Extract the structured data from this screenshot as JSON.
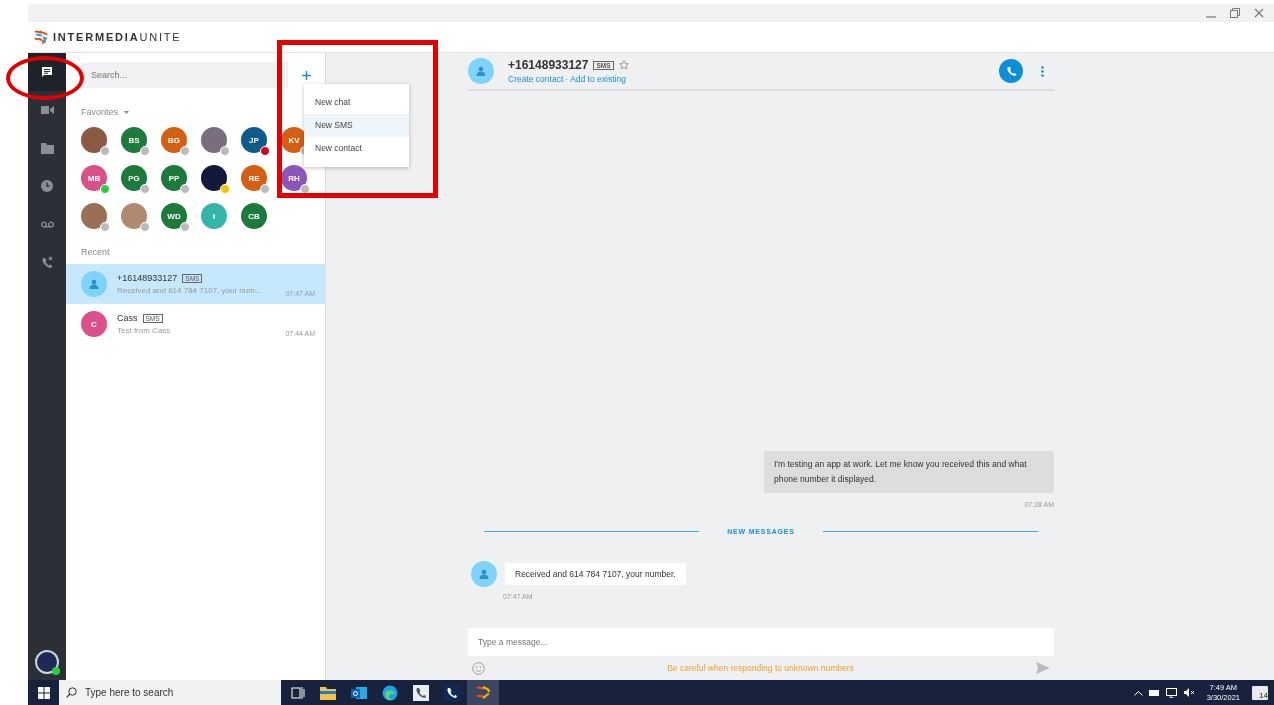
{
  "window": {
    "brand_bold": "INTERMEDIA",
    "brand_light": "UNITE"
  },
  "nav": [
    {
      "kind": "chat",
      "selected": true
    },
    {
      "kind": "video",
      "selected": false
    },
    {
      "kind": "folder",
      "selected": false
    },
    {
      "kind": "clock",
      "selected": false
    },
    {
      "kind": "voicemail",
      "selected": false
    },
    {
      "kind": "phone",
      "selected": false
    }
  ],
  "user_status": {
    "color": "#2ecc40"
  },
  "search": {
    "placeholder": "Search..."
  },
  "new_menu": [
    {
      "label": "New chat",
      "selected": false
    },
    {
      "label": "New SMS",
      "selected": true
    },
    {
      "label": "New contact",
      "selected": false
    }
  ],
  "favorites_label": "Favorites",
  "favorites": [
    {
      "kind": "photo",
      "color": "#8a5a44",
      "status": {
        "color": "#bbbbbb"
      }
    },
    {
      "kind": "initials",
      "initials": "BS",
      "color": "#1e7a3c",
      "status": {
        "color": "#bbbbbb"
      }
    },
    {
      "kind": "initials",
      "initials": "BG",
      "color": "#d35f12",
      "status": {
        "color": "#bbbbbb"
      }
    },
    {
      "kind": "photo",
      "color": "#7a6e7e",
      "status": {
        "color": "#bbbbbb"
      }
    },
    {
      "kind": "initials",
      "initials": "JP",
      "color": "#0e5a8a",
      "status": {
        "color": "#d0021b"
      }
    },
    {
      "kind": "initials",
      "initials": "KV",
      "color": "#d35f12",
      "status": {
        "color": "#bbbbbb"
      }
    },
    {
      "kind": "initials",
      "initials": "MB",
      "color": "#d9508a",
      "status": {
        "color": "#2ecc40"
      }
    },
    {
      "kind": "initials",
      "initials": "PG",
      "color": "#1e7a3c",
      "status": {
        "color": "#bbbbbb"
      }
    },
    {
      "kind": "initials",
      "initials": "PP",
      "color": "#1e7a3c",
      "status": {
        "color": "#bbbbbb"
      }
    },
    {
      "kind": "photo",
      "color": "#111a3a",
      "status": {
        "color": "#f5c400"
      }
    },
    {
      "kind": "initials",
      "initials": "RE",
      "color": "#d35f12",
      "status": {
        "color": "#bbbbbb"
      }
    },
    {
      "kind": "initials",
      "initials": "RH",
      "color": "#8e55b8",
      "status": {
        "color": "#bbbbbb"
      }
    },
    {
      "kind": "photo",
      "color": "#9a7055",
      "status": {
        "color": "#bbbbbb"
      }
    },
    {
      "kind": "photo",
      "color": "#b08a70",
      "status": {
        "color": "#bbbbbb"
      }
    },
    {
      "kind": "initials",
      "initials": "WD",
      "color": "#1e7a3c",
      "status": {
        "color": "#bbbbbb"
      }
    },
    {
      "kind": "initials",
      "initials": "I",
      "color": "#35b5a8"
    },
    {
      "kind": "initials",
      "initials": "CB",
      "color": "#1e7a3c"
    }
  ],
  "recent_label": "Recent",
  "recent": [
    {
      "kind": "unknown",
      "color": "#7fd3fb",
      "name": "+16148933127",
      "tag": "SMS",
      "preview": "Received and 614 784 7107, your num...",
      "time": "07:47 AM",
      "selected": true
    },
    {
      "kind": "initials",
      "initials": "C",
      "color": "#d9508a",
      "name": "Cass",
      "tag": "SMS",
      "preview": "Test from Cass",
      "time": "07:44 AM",
      "selected": false
    }
  ],
  "conversation": {
    "name": "+16148933127",
    "tag": "SMS",
    "starred": false,
    "create_link": "Create contact",
    "separator": "·",
    "add_link": "Add to existing",
    "messages": [
      {
        "kind": "outgoing",
        "text": "I'm testing an app at work.  Let me know you received this and what phone number it displayed.",
        "time": "07:28 AM"
      },
      {
        "kind": "divider",
        "text": "NEW MESSAGES"
      },
      {
        "kind": "incoming",
        "text": "Received and 614 784 7107, your number.",
        "time": "07:47 AM"
      }
    ],
    "input_placeholder": "Type a message...",
    "warning": "Be careful when responding to unknown numbers"
  },
  "taskbar": {
    "search_placeholder": "Type here to search",
    "time": "7:49 AM",
    "date": "3/30/2021",
    "notifications": "14"
  }
}
